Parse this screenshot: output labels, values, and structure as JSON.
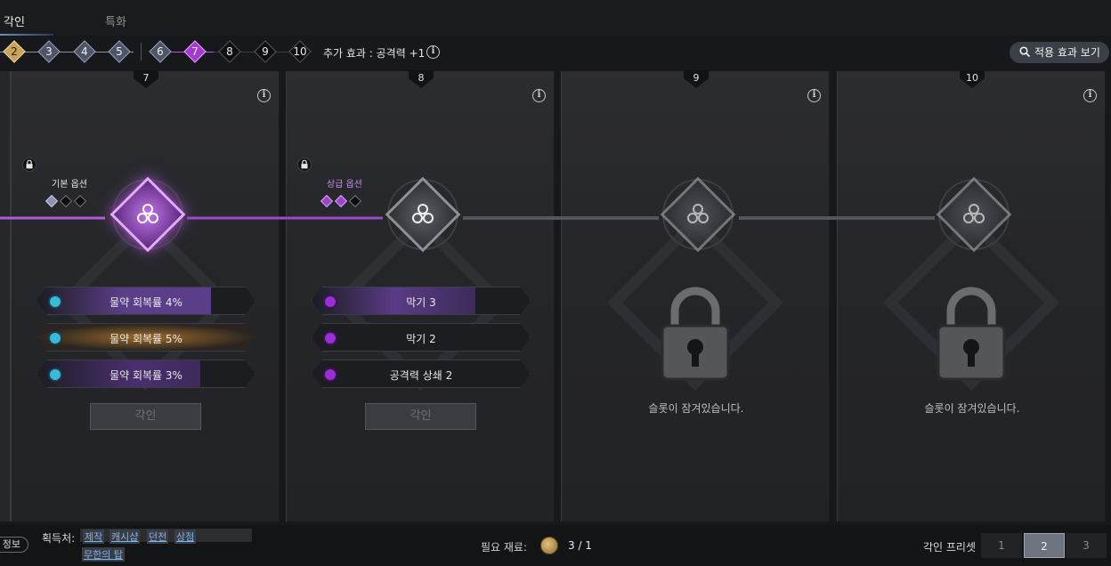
{
  "tabs": {
    "engrave": "각인",
    "special": "특화"
  },
  "levels": {
    "l2": "2",
    "l3": "3",
    "l4": "4",
    "l5": "5",
    "l6": "6",
    "l7": "7",
    "l8": "8",
    "l9": "9",
    "l10": "10"
  },
  "extra_effect": "추가 효과 : 공격력 +1",
  "view_effects_button": "적용 효과 보기",
  "panels": [
    {
      "number": "7",
      "option_label": "기본 옵션",
      "options": [
        "물약 회복률 4%",
        "물약 회복률 5%",
        "물약 회복률 3%"
      ],
      "engrave_button": "각인"
    },
    {
      "number": "8",
      "option_label": "상급 옵션",
      "options": [
        "막기 3",
        "막기 2",
        "공격력 상쇄 2"
      ],
      "engrave_button": "각인"
    },
    {
      "number": "9",
      "locked_message": "슬롯이 잠겨있습니다."
    },
    {
      "number": "10",
      "locked_message": "슬롯이 잠겨있습니다."
    }
  ],
  "bottom": {
    "info_tab": "정보",
    "acquire_label": "획득처:",
    "acquire_links": [
      "제작",
      "캐시샵",
      "던전",
      "상점",
      "무한의 탑"
    ],
    "material_label": "필요 재료:",
    "material_count": "3 / 1",
    "preset_label": "각인 프리셋",
    "presets": [
      "1",
      "2",
      "3"
    ]
  },
  "colors": {
    "accent_purple": "#b05ad8",
    "gold": "#c9a25b",
    "teal_dot": "#3bb9d6",
    "purple_dot": "#9b2fd6"
  }
}
